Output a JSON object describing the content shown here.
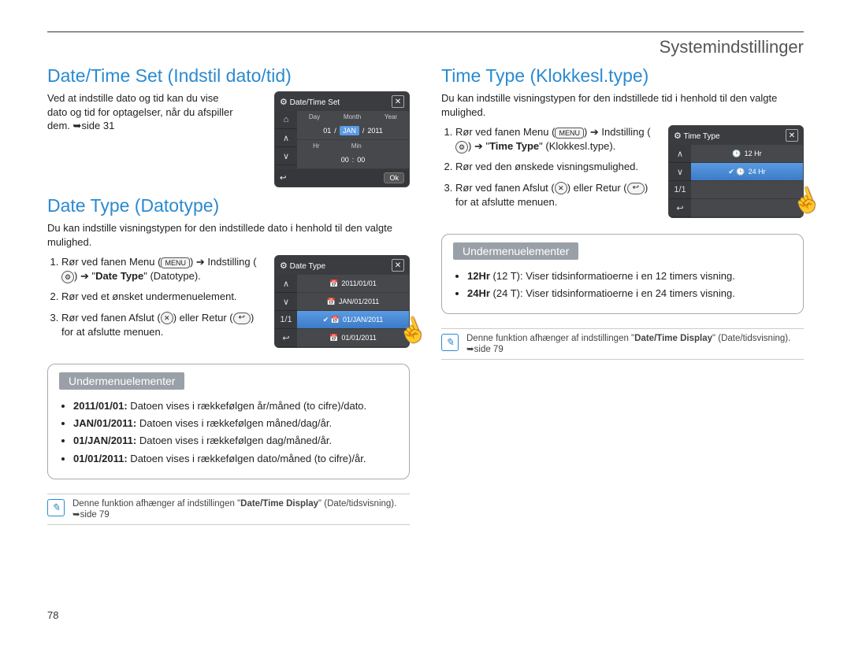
{
  "header": "Systemindstillinger",
  "pageNumber": "78",
  "left": {
    "sec1": {
      "title": "Date/Time Set (Indstil dato/tid)",
      "intro": "Ved at indstille dato og tid kan du vise dato og tid for optagelser, når du afspiller dem. ➥side 31"
    },
    "sec2": {
      "title": "Date Type (Datotype)",
      "intro": "Du kan indstille visningstypen for den indstillede dato i henhold til den valgte mulighed.",
      "step1a": "Rør ved fanen Menu (",
      "step1b": ") ➔ Indstilling (",
      "step1c": ") ➔ \"",
      "step1_bold": "Date Type",
      "step1d": "\" (Datotype).",
      "step2": "Rør ved et ønsket undermenuelement.",
      "step3a": "Rør ved fanen Afslut (",
      "step3b": ") eller Retur (",
      "step3c": ") for at afslutte menuen.",
      "submenu_title": "Undermenuelementer",
      "items": {
        "a_bold": "2011/01/01:",
        "a_text": " Datoen vises i rækkefølgen år/måned (to cifre)/dato.",
        "b_bold": "JAN/01/2011:",
        "b_text": " Datoen vises i rækkefølgen måned/dag/år.",
        "c_bold": "01/JAN/2011:",
        "c_text": " Datoen vises i rækkefølgen dag/måned/år.",
        "d_bold": "01/01/2011:",
        "d_text": " Datoen vises i rækkefølgen dato/måned (to cifre)/år."
      },
      "note_a": "Denne funktion afhænger af indstillingen \"",
      "note_bold": "Date/Time Display",
      "note_b": "\" (Date/tidsvisning). ➥side 79"
    },
    "ui1": {
      "title": "Date/Time Set",
      "labels": {
        "day": "Day",
        "month": "Month",
        "year": "Year",
        "hr": "Hr",
        "min": "Min"
      },
      "vals": {
        "day": "01",
        "month": "JAN",
        "year": "2011",
        "hr": "00",
        "min": "00"
      },
      "ok": "Ok"
    },
    "ui2": {
      "title": "Date Type",
      "rows": {
        "r1": "2011/01/01",
        "r2": "JAN/01/2011",
        "r3": "01/JAN/2011",
        "r4": "01/01/2011"
      },
      "page": "1/1"
    }
  },
  "right": {
    "sec1": {
      "title": "Time Type (Klokkesl.type)",
      "intro": "Du kan indstille visningstypen for den indstillede tid i henhold til den valgte mulighed.",
      "step1a": "Rør ved fanen Menu (",
      "step1b": ") ➔ Indstilling (",
      "step1c": ") ➔ \"",
      "step1_bold": "Time Type",
      "step1d": "\" (Klokkesl.type).",
      "step2": "Rør ved den ønskede visningsmulighed.",
      "step3a": "Rør ved fanen Afslut (",
      "step3b": ") eller Retur (",
      "step3c": ") for at afslutte menuen.",
      "submenu_title": "Undermenuelementer",
      "items": {
        "a_bold": "12Hr",
        "a_text": " (12 T): Viser tidsinformatioerne i en 12 timers visning.",
        "b_bold": "24Hr",
        "b_text": " (24 T): Viser tidsinformatioerne i en 24 timers visning."
      },
      "note_a": "Denne funktion afhænger af indstillingen \"",
      "note_bold": "Date/Time Display",
      "note_b": "\" (Date/tidsvisning). ➥side 79"
    },
    "ui": {
      "title": "Time Type",
      "rows": {
        "r1": "12 Hr",
        "r2": "24 Hr"
      },
      "page": "1/1"
    }
  },
  "chips": {
    "menu": "MENU",
    "close": "✕",
    "return": "↩"
  }
}
